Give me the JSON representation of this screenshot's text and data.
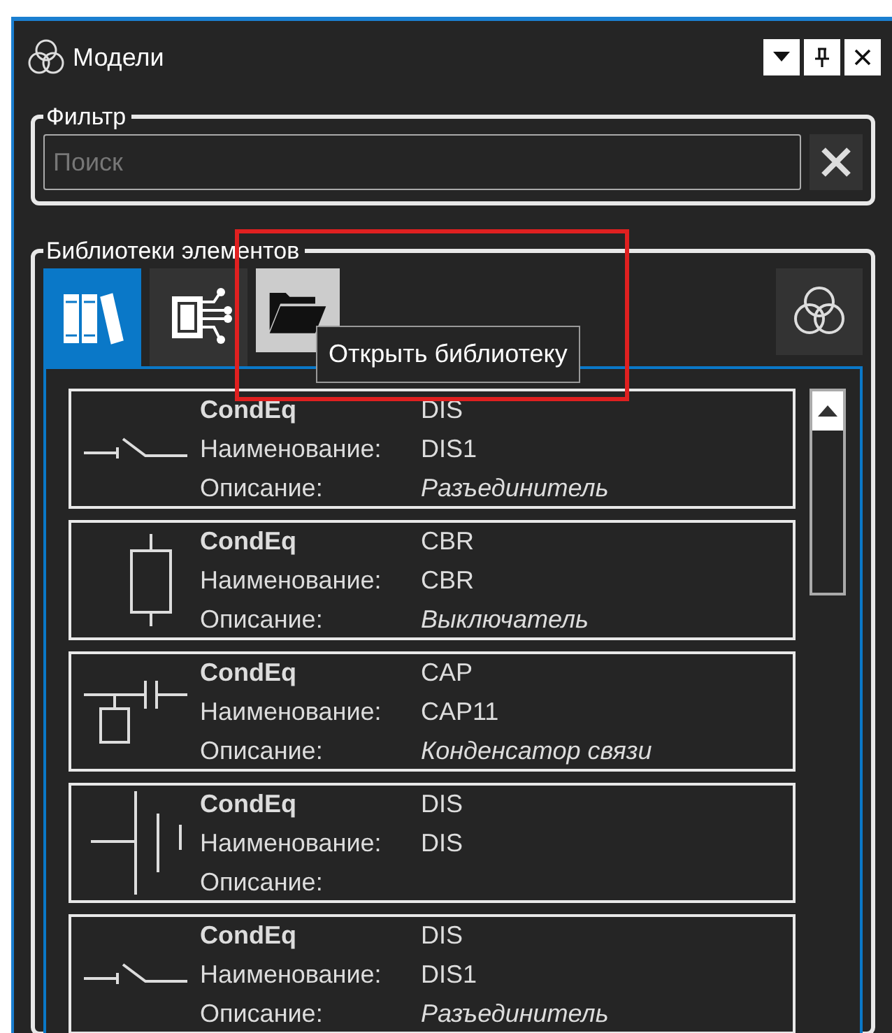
{
  "window": {
    "title": "Модели",
    "buttons": [
      {
        "kind": "menu"
      },
      {
        "kind": "pin"
      },
      {
        "kind": "close"
      }
    ]
  },
  "filter": {
    "label": "Фильтр",
    "search": {
      "placeholder": "Поиск"
    }
  },
  "library": {
    "label": "Библиотеки элементов",
    "tabs": [
      {
        "kind": "books",
        "selected": true,
        "hovered": false
      },
      {
        "kind": "chip",
        "selected": false,
        "hovered": false
      },
      {
        "kind": "folder",
        "selected": false,
        "hovered": true
      }
    ],
    "tooltip": "Открыть библиотеку",
    "elements": [
      {
        "kind": "switch",
        "class": "CondEq",
        "type": "DIS",
        "name_label": "Наименование:",
        "name": "DIS1",
        "description_label": "Описание:",
        "description": "Разъединитель"
      },
      {
        "kind": "breaker",
        "class": "CondEq",
        "type": "CBR",
        "name_label": "Наименование:",
        "name": "CBR",
        "description_label": "Описание:",
        "description": "Выключатель"
      },
      {
        "kind": "capacitor",
        "class": "CondEq",
        "type": "CAP",
        "name_label": "Наименование:",
        "name": "CAP11",
        "description_label": "Описание:",
        "description": "Конденсатор связи"
      },
      {
        "kind": "bus-switch",
        "class": "CondEq",
        "type": "DIS",
        "name_label": "Наименование:",
        "name": "DIS",
        "description_label": "Описание:"
      },
      {
        "kind": "switch",
        "class": "CondEq",
        "type": "DIS",
        "name_label": "Наименование:",
        "name": "DIS1",
        "description_label": "Описание:",
        "description": "Разъединитель"
      }
    ]
  }
}
